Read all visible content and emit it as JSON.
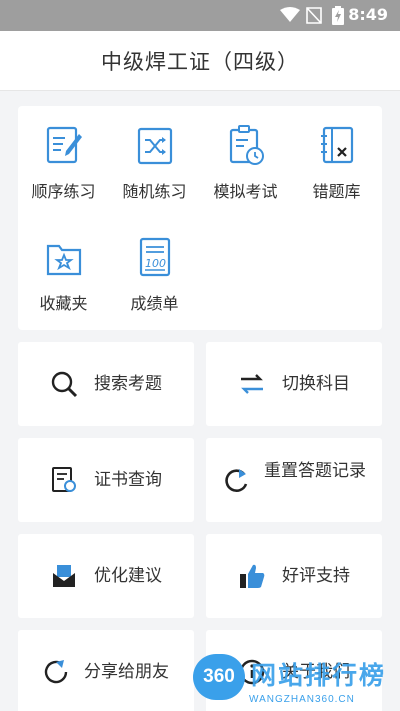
{
  "statusbar": {
    "time": "8:49"
  },
  "header": {
    "title": "中级焊工证（四级）"
  },
  "grid": [
    {
      "label": "顺序练习",
      "icon": "sequential-practice-icon"
    },
    {
      "label": "随机练习",
      "icon": "random-practice-icon"
    },
    {
      "label": "模拟考试",
      "icon": "mock-exam-icon"
    },
    {
      "label": "错题库",
      "icon": "wrong-questions-icon"
    },
    {
      "label": "收藏夹",
      "icon": "favorites-icon"
    },
    {
      "label": "成绩单",
      "icon": "transcript-icon"
    }
  ],
  "tiles": [
    {
      "label": "搜索考题",
      "icon": "search-icon"
    },
    {
      "label": "切换科目",
      "icon": "switch-icon"
    },
    {
      "label": "证书查询",
      "icon": "certificate-icon"
    },
    {
      "label": "重置答题记录",
      "icon": "reset-icon"
    },
    {
      "label": "优化建议",
      "icon": "mail-icon"
    },
    {
      "label": "好评支持",
      "icon": "thumbs-up-icon"
    },
    {
      "label": "分享给朋友",
      "icon": "share-icon"
    },
    {
      "label": "关于我们",
      "icon": "info-icon"
    }
  ],
  "watermark": {
    "badge": "360",
    "text": "网站排行榜",
    "url": "WANGZHAN360.CN"
  },
  "colors": {
    "accent": "#3a8fd9",
    "statusbar": "#9e9e9e"
  }
}
